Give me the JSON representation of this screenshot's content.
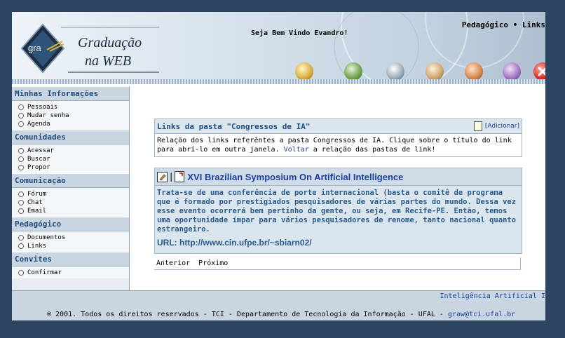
{
  "header": {
    "logo_text": "gra",
    "logo_title_line1": "Graduação",
    "logo_title_line2": "na WEB",
    "welcome": "Seja Bem Vindo Evandro!",
    "topnav": {
      "item1": "Pedagógico",
      "separator": "•",
      "item2": "Links"
    },
    "toolbar_icons": [
      "home-icon",
      "tools-icon",
      "notes-icon",
      "edit-icon",
      "user-icon",
      "book-icon",
      "close-icon"
    ]
  },
  "sidebar": {
    "sections": [
      {
        "title": "Minhas Informações",
        "items": [
          "Pessoais",
          "Mudar senha",
          "Agenda"
        ]
      },
      {
        "title": "Comunidades",
        "items": [
          "Acessar",
          "Buscar",
          "Propor"
        ]
      },
      {
        "title": "Comunicação",
        "items": [
          "Fórum",
          "Chat",
          "Email"
        ]
      },
      {
        "title": "Pedagógico",
        "items": [
          "Documentos",
          "Links"
        ]
      },
      {
        "title": "Convites",
        "items": [
          "Confirmar"
        ]
      }
    ]
  },
  "folder_panel": {
    "title": "Links da pasta \"Congressos de IA\"",
    "add_label": "[Adicionar]",
    "text_before": "Relação dos links referêntes a pasta Congressos de IA. Clique sobre o título do link para abrí-lo em outra janela.",
    "back_link": "Voltar",
    "text_after": "a relação das pastas de link!"
  },
  "link_item": {
    "separator": "|",
    "title": "XVI Brazilian Symposium On Artificial Intelligence",
    "description": "Trata-se de uma conferência de porte internacional (basta o comitê de programa que é formado por prestigiados pesquisadores de várias partes do mundo. Dessa vez esse evento ocorrerá bem pertinho da gente, ou seja, em Recife-PE. Então, temos uma oportunidade ímpar para vários pesquisadores de renome, tanto nacional quanto estrangeiro.",
    "url": "URL: http://www.cin.ufpe.br/~sbiarn02/"
  },
  "pager": {
    "prev": "Anterior",
    "next": "Próximo"
  },
  "footer": {
    "link": "Inteligência Artificial I",
    "copyright": "® 2001. Todos os direitos reservados - TCI - Departamento de Tecnologia da Informação - UFAL -",
    "email": "graw@tci.ufal.br"
  }
}
